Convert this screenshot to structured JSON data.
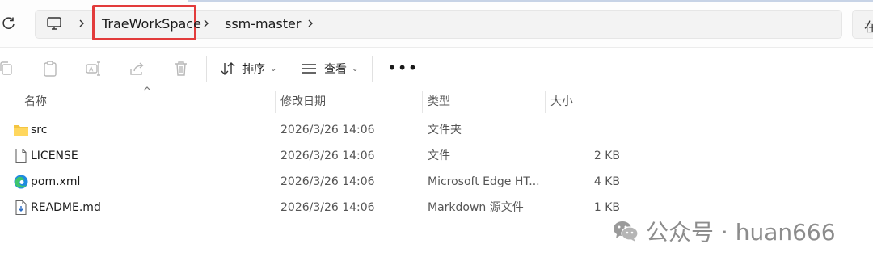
{
  "address_bar": {
    "crumbs": [
      "TraeWorkSpace",
      "ssm-master"
    ],
    "search_placeholder_partial": "在"
  },
  "toolbar": {
    "sort_label": "排序",
    "view_label": "查看",
    "more_label": "•••"
  },
  "columns": {
    "name": "名称",
    "date": "修改日期",
    "type": "类型",
    "size": "大小"
  },
  "files": [
    {
      "name": "src",
      "date": "2026/3/26 14:06",
      "type": "文件夹",
      "size": "",
      "icon": "folder-icon"
    },
    {
      "name": "LICENSE",
      "date": "2026/3/26 14:06",
      "type": "文件",
      "size": "2 KB",
      "icon": "file-icon"
    },
    {
      "name": "pom.xml",
      "date": "2026/3/26 14:06",
      "type": "Microsoft Edge HT...",
      "size": "4 KB",
      "icon": "edge-icon"
    },
    {
      "name": "README.md",
      "date": "2026/3/26 14:06",
      "type": "Markdown 源文件",
      "size": "1 KB",
      "icon": "markdown-file-icon"
    }
  ],
  "watermark": {
    "text": "公众号 · huan666",
    "icon": "wechat-icon"
  },
  "colors": {
    "highlight_border": "#e23b3b",
    "folder": "#f4c542",
    "edge_blue": "#1f8be0",
    "edge_green": "#3ec46d"
  }
}
